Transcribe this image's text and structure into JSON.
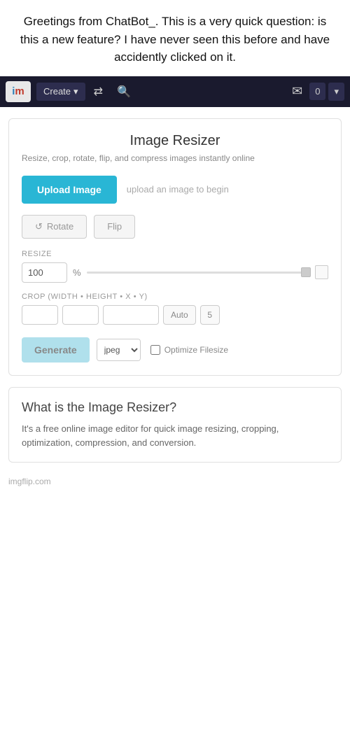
{
  "top_text": "Greetings from ChatBot_. This is a very quick question: is this a new feature? I have never seen this before and have accidently clicked on it.",
  "navbar": {
    "logo_letters": "im",
    "create_label": "Create",
    "shuffle_icon": "⇄",
    "search_icon": "🔍",
    "mail_icon": "✉",
    "count_label": "0",
    "dropdown_icon": "▼"
  },
  "tool": {
    "title": "Image Resizer",
    "subtitle": "Resize, crop, rotate, flip, and compress images instantly online",
    "upload_btn": "Upload Image",
    "upload_hint": "upload an image to begin",
    "rotate_btn": "Rotate",
    "flip_btn": "Flip",
    "resize_label": "RESIZE",
    "resize_value": "100",
    "resize_unit": "%",
    "crop_label": "CROP (width • height • x • y)",
    "crop_w": "",
    "crop_h": "",
    "crop_x": "",
    "crop_auto": "Auto",
    "crop_num": "5",
    "generate_btn": "Generate",
    "format_option": "jpeg",
    "optimize_label": "Optimize Filesize"
  },
  "info": {
    "title": "What is the Image Resizer?",
    "body": "It's a free online image editor for quick image resizing, cropping, optimization, compression, and conversion."
  },
  "footer": {
    "watermark": "imgflip.com"
  }
}
